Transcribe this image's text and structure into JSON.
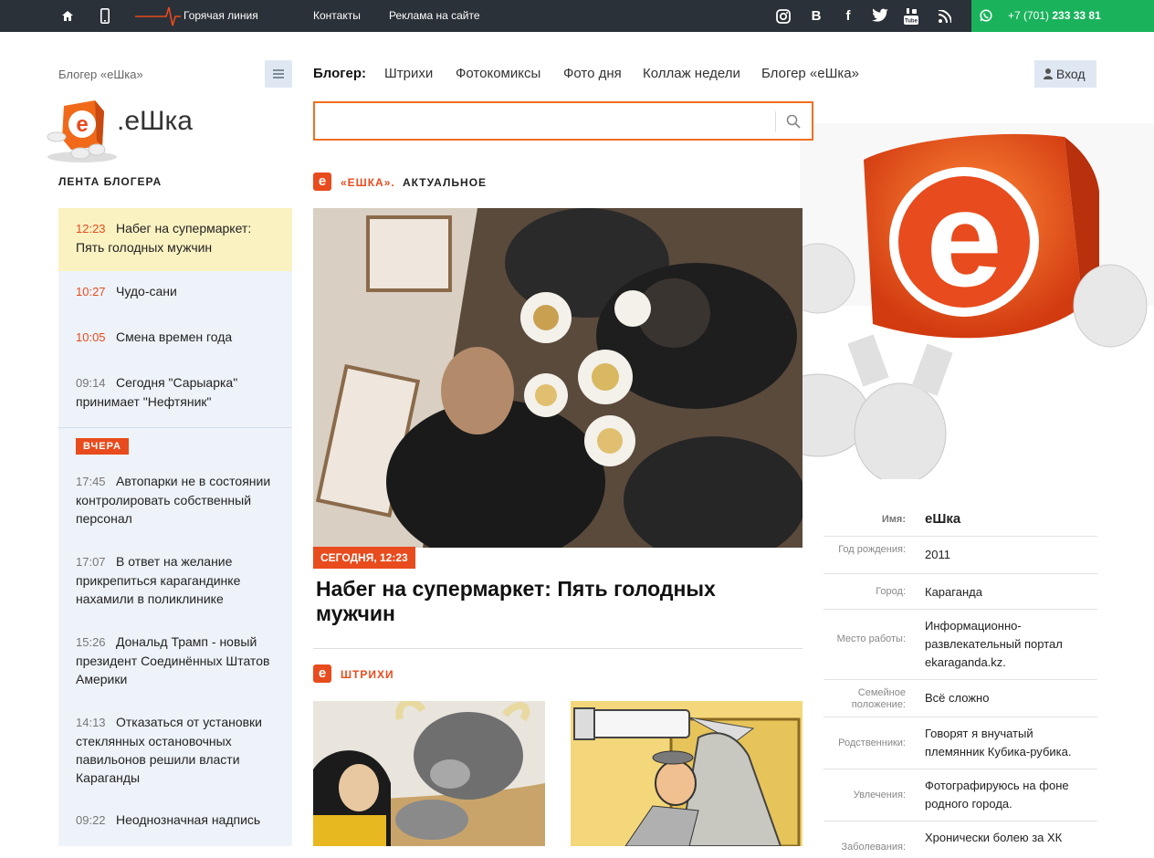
{
  "topbar": {
    "hotline_label": "Горячая линия",
    "links": [
      "Контакты",
      "Реклама на сайте"
    ],
    "social_icons": [
      "instagram-icon",
      "vk-icon",
      "facebook-icon",
      "twitter-icon",
      "youtube-icon",
      "rss-icon"
    ],
    "phone_prefix": "+7 (701)",
    "phone_number": "233 33 81",
    "phone_bg": "#1ab35c"
  },
  "sidebar": {
    "breadcrumb": "Блогер «еШка»",
    "logo_text": ".еШка",
    "feed_title": "ЛЕНТА БЛОГЕРА",
    "yesterday_badge": "ВЧЕРА",
    "today": [
      {
        "time": "12:23",
        "title": "Набег на супермаркет: Пять голодных мужчин"
      },
      {
        "time": "10:27",
        "title": "Чудо-сани"
      },
      {
        "time": "10:05",
        "title": "Смена времен года"
      },
      {
        "time": "09:14",
        "title": "Сегодня \"Сарыарка\" принимает \"Нефтяник\""
      }
    ],
    "yesterday": [
      {
        "time": "17:45",
        "title": "Автопарки не в состоянии контролировать собственный персонал"
      },
      {
        "time": "17:07",
        "title": "В ответ на желание прикрепиться карагандинке нахамили в поликлинике"
      },
      {
        "time": "15:26",
        "title": "Дональд Трамп - новый президент Соединённых Штатов Америки"
      },
      {
        "time": "14:13",
        "title": "Отказаться от установки стеклянных остановочных павильонов решили власти Караганды"
      },
      {
        "time": "09:22",
        "title": "Неоднозначная надпись"
      }
    ]
  },
  "nav": {
    "label": "Блогер:",
    "items": [
      "Штрихи",
      "Фотокомиксы",
      "Фото дня",
      "Коллаж недели",
      "Блогер «еШка»"
    ],
    "login": "Вход"
  },
  "search": {
    "placeholder": ""
  },
  "main": {
    "section1_brand": "«ЕШКА».",
    "section1_title": "АКТУАЛЬНОЕ",
    "date_badge": "СЕГОДНЯ, 12:23",
    "headline": "Набег на супермаркет: Пять голодных мужчин",
    "section2_title": "ШТРИХИ"
  },
  "profile": [
    {
      "key": "Имя:",
      "value": "еШка"
    },
    {
      "key": "Год рождения:",
      "value": "2011"
    },
    {
      "key": "Город:",
      "value": "Караганда"
    },
    {
      "key": "Место работы:",
      "value": "Информационно-развлекательный портал ekaraganda.kz."
    },
    {
      "key": "Семейное положение:",
      "value": "Всё сложно"
    },
    {
      "key": "Родственники:",
      "value": "Говорят я внучатый племянник Кубика-рубика."
    },
    {
      "key": "Увлечения:",
      "value": "Фотографируюсь на фоне родного города."
    },
    {
      "key": "Заболевания:",
      "value": "Хронически болею за ХК"
    }
  ],
  "colors": {
    "accent": "#e84b1d",
    "topbar": "#2b3138",
    "feed_bg": "#eef3f9",
    "highlight": "#fbf2c2"
  }
}
